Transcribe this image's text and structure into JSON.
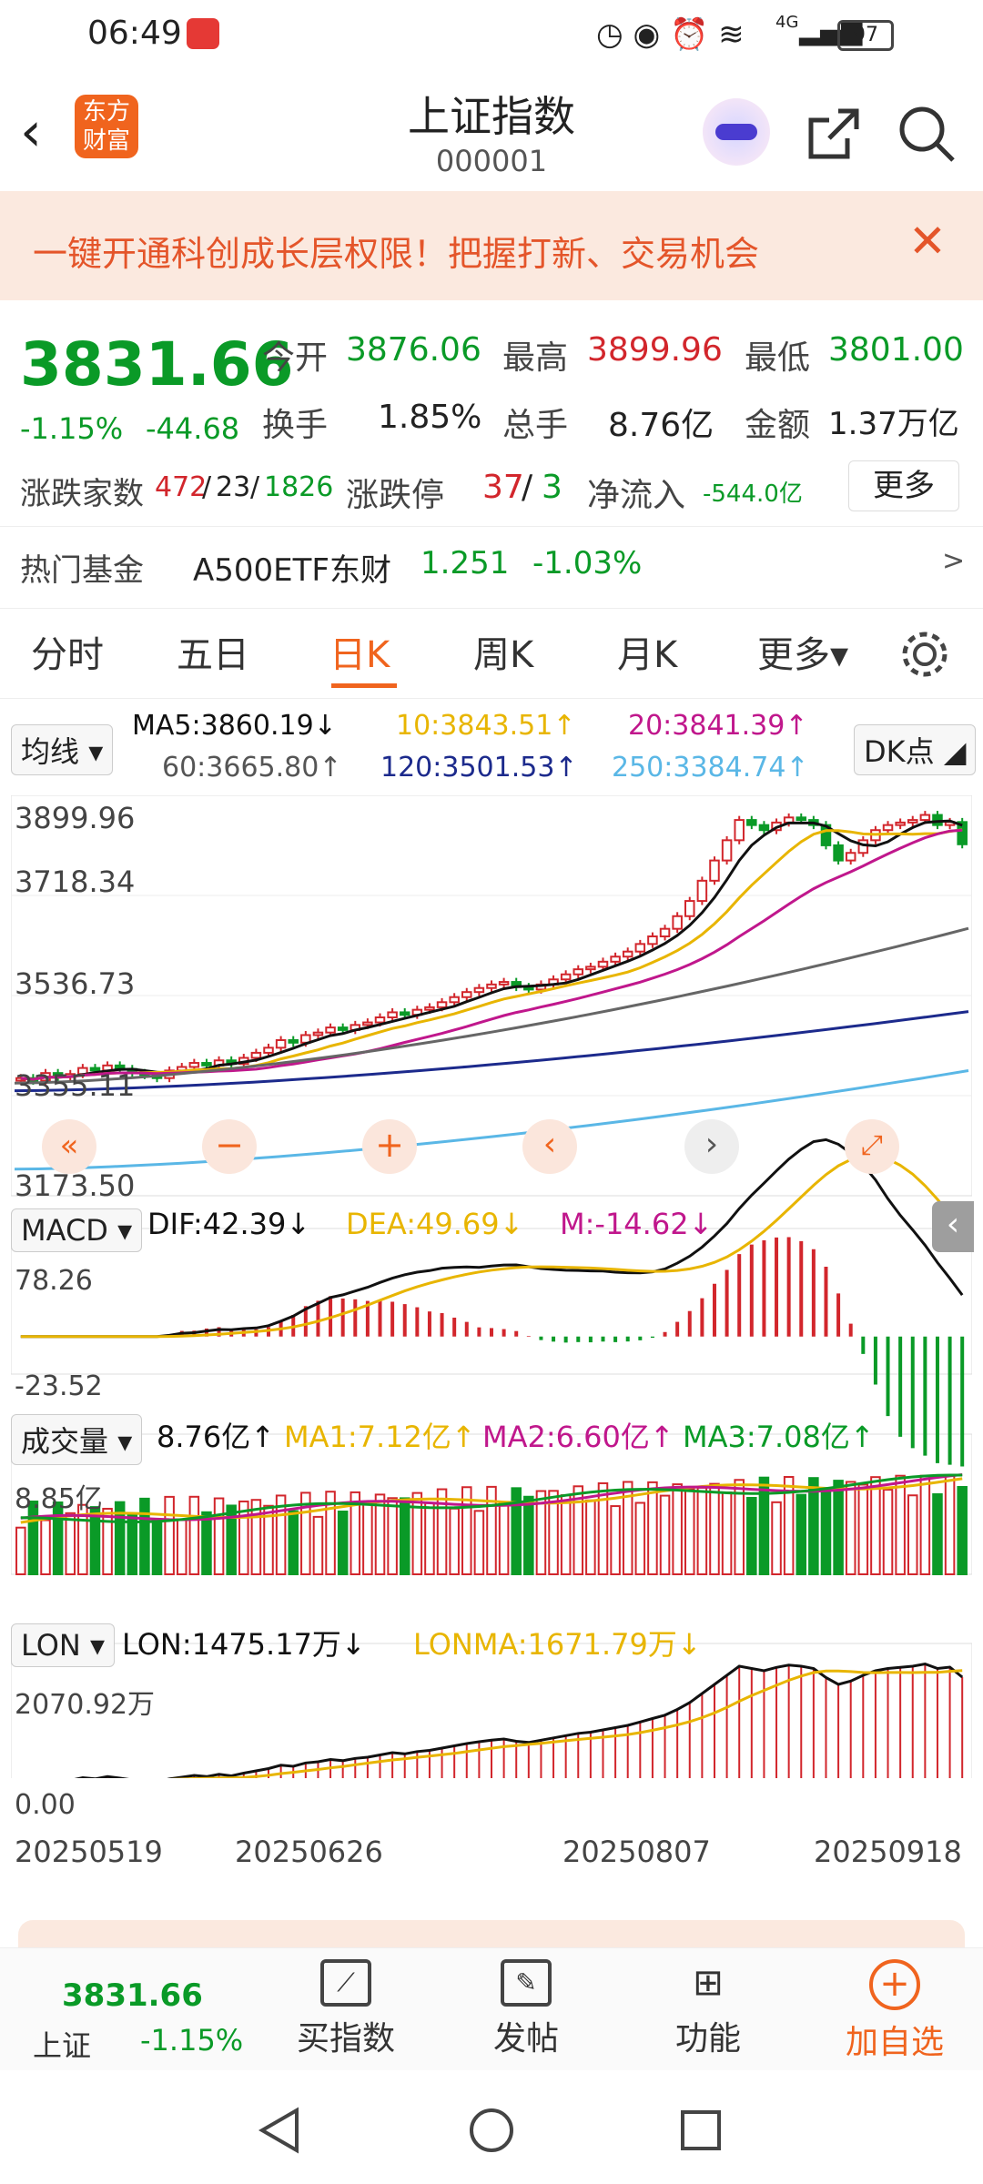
{
  "status": {
    "time": "06:49",
    "battery": "97",
    "net": "4G"
  },
  "header": {
    "title": "上证指数",
    "code": "000001",
    "logo_top": "东方",
    "logo_bottom": "财富"
  },
  "banner": {
    "text": "一键开通科创成长层权限！把握打新、交易机会"
  },
  "quote": {
    "price": "3831.66",
    "pct": "-1.15%",
    "chg": "-44.68",
    "open_label": "今开",
    "open": "3876.06",
    "high_label": "最高",
    "high": "3899.96",
    "low_label": "最低",
    "low": "3801.00",
    "turnover_label": "换手",
    "turnover": "1.85%",
    "volume_label": "总手",
    "volume": "8.76亿",
    "amount_label": "金额",
    "amount": "1.37万亿",
    "breadth_label": "涨跌家数",
    "up": "472",
    "flat": "23",
    "down": "1826",
    "limit_label": "涨跌停",
    "limit_up": "37",
    "limit_down": "3",
    "flow_label": "净流入",
    "flow": "-544.0亿",
    "more": "更多",
    "fund_label": "热门基金",
    "fund_name": "A500ETF东财",
    "fund_price": "1.251",
    "fund_pct": "-1.03%",
    "fund_arrow": ">"
  },
  "tabs": [
    "分时",
    "五日",
    "日K",
    "周K",
    "月K",
    "更多▾"
  ],
  "ma_row": {
    "selector": "均线",
    "ma5": "MA5:3860.19↓",
    "ma10": "10:3843.51↑",
    "ma20": "20:3841.39↑",
    "ma60": "60:3665.80↑",
    "ma120": "120:3501.53↑",
    "ma250": "250:3384.74↑",
    "dk": "DK点"
  },
  "k_axis": [
    "3899.96",
    "3718.34",
    "3536.73",
    "3355.11",
    "3173.50"
  ],
  "macd": {
    "selector": "MACD",
    "dif": "DIF:42.39↓",
    "dea": "DEA:49.69↓",
    "m": "M:-14.62↓",
    "top": "78.26",
    "bottom": "-23.52"
  },
  "vol": {
    "selector": "成交量",
    "v": "8.76亿↑",
    "ma1": "MA1:7.12亿↑",
    "ma2": "MA2:6.60亿↑",
    "ma3": "MA3:7.08亿↑",
    "top": "8.85亿"
  },
  "lon": {
    "selector": "LON",
    "lon": "LON:1475.17万↓",
    "lonma": "LONMA:1671.79万↓",
    "top": "2070.92万",
    "bottom": "0.00"
  },
  "dates": [
    "20250519",
    "20250626",
    "20250807",
    "20250918"
  ],
  "bottomnav": {
    "price": "3831.66",
    "name": "上证",
    "pct": "-1.15%",
    "buy": "买指数",
    "post": "发帖",
    "func": "功能",
    "add": "加自选"
  },
  "colors": {
    "up": "#d2262c",
    "down": "#0a9a27",
    "accent": "#f0641e",
    "ma5": "#111111",
    "ma10": "#e8b500",
    "ma20": "#c0178c",
    "ma60": "#666666",
    "ma120": "#1c2a8c",
    "ma250": "#5ab7e6"
  },
  "chart_data": [
    {
      "type": "candlestick",
      "title": "",
      "y_range": [
        3173.5,
        3899.96
      ],
      "ma5_end": 3860.19,
      "ma10_end": 3843.51,
      "ma20_end": 3841.39,
      "ma60_end": 3665.8,
      "ma120_end": 3501.53,
      "ma250_end": 3384.74,
      "close_series": [
        3370,
        3365,
        3380,
        3372,
        3378,
        3390,
        3385,
        3395,
        3388,
        3380,
        3376,
        3370,
        3385,
        3392,
        3400,
        3395,
        3405,
        3398,
        3410,
        3420,
        3430,
        3445,
        3440,
        3455,
        3460,
        3470,
        3465,
        3475,
        3480,
        3490,
        3500,
        3495,
        3505,
        3510,
        3520,
        3530,
        3540,
        3548,
        3555,
        3560,
        3550,
        3545,
        3555,
        3565,
        3575,
        3585,
        3590,
        3600,
        3610,
        3620,
        3635,
        3650,
        3665,
        3690,
        3720,
        3760,
        3800,
        3840,
        3880,
        3870,
        3860,
        3875,
        3885,
        3880,
        3870,
        3830,
        3800,
        3815,
        3840,
        3860,
        3870,
        3875,
        3880,
        3890,
        3870,
        3876,
        3832
      ]
    },
    {
      "type": "bar",
      "title": "",
      "series": [
        {
          "name": "DIF",
          "end": 42.39
        },
        {
          "name": "DEA",
          "end": 49.69
        },
        {
          "name": "M",
          "end": -14.62
        }
      ],
      "y_range": [
        -23.52,
        78.26
      ]
    },
    {
      "type": "bar",
      "title": "",
      "series": [
        {
          "name": "成交量",
          "end": "8.76亿"
        }
      ],
      "y_max": "8.85亿"
    },
    {
      "type": "area",
      "title": "",
      "series": [
        {
          "name": "LON",
          "end": "1475.17万"
        },
        {
          "name": "LONMA",
          "end": "1671.79万"
        }
      ],
      "y_range": [
        "0.00",
        "2070.92万"
      ]
    }
  ]
}
